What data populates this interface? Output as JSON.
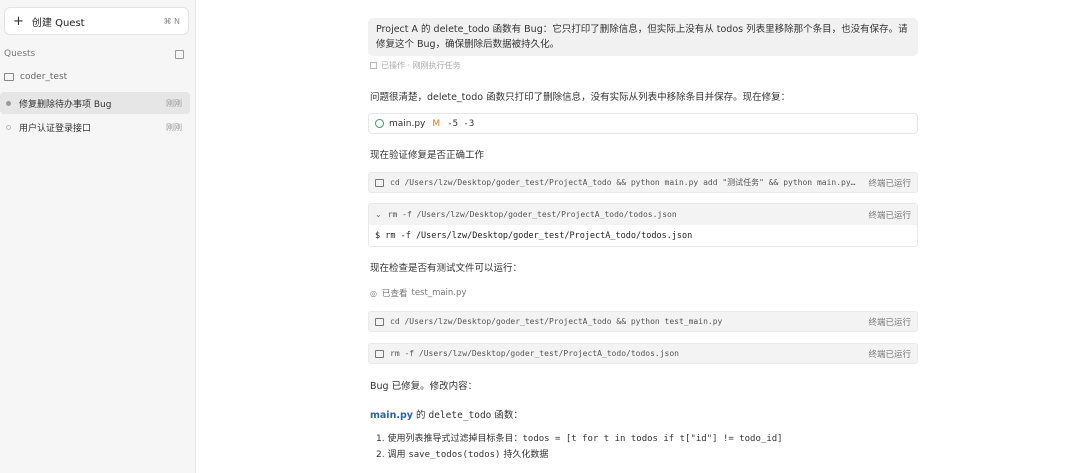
{
  "sidebar": {
    "new_quest_label": "创建 Quest",
    "new_quest_shortcut": "⌘ N",
    "section_title": "Quests",
    "project_name": "coder_test",
    "quests": [
      {
        "title": "修复删除待办事项 Bug",
        "time": "刚刚"
      },
      {
        "title": "用户认证登录接口",
        "time": "刚刚"
      }
    ]
  },
  "chat": {
    "user_message": "Project A 的 delete_todo 函数有 Bug：它只打印了删除信息，但实际上没有从 todos 列表里移除那个条目，也没有保存。请修复这个 Bug，确保删除后数据被持久化。",
    "message_meta": "已操作 · 刚刚执行任务",
    "intro": "问题很清楚，delete_todo 函数只打印了删除信息，没有实际从列表中移除条目并保存。现在修复：",
    "file_edit": {
      "name": "main.py",
      "status": "M",
      "diff": "-5 -3"
    },
    "verify_text": "现在验证修复是否正确工作",
    "cmd1": {
      "text": "cd /Users/lzw/Desktop/goder_test/ProjectA_todo && python main.py add \"测试任务\" && python main.py ad...",
      "status": "终端已运行"
    },
    "cmd2": {
      "text": "rm -f /Users/lzw/Desktop/goder_test/ProjectA_todo/todos.json",
      "status": "终端已运行",
      "output": "$ rm -f /Users/lzw/Desktop/goder_test/ProjectA_todo/todos.json"
    },
    "check_text": "现在检查是否有测试文件可以运行：",
    "viewed_label": "已查看",
    "viewed_file": "test_main.py",
    "cmd3": {
      "text": "cd /Users/lzw/Desktop/goder_test/ProjectA_todo && python test_main.py",
      "status": "终端已运行"
    },
    "cmd4": {
      "text": "rm -f /Users/lzw/Desktop/goder_test/ProjectA_todo/todos.json",
      "status": "终端已运行"
    },
    "fixed_text": "Bug 已修复。修改内容：",
    "fn_file": "main.py",
    "fn_mid": " 的 ",
    "fn_name": "delete_todo",
    "fn_tail": " 函数：",
    "list": [
      {
        "n": "1.",
        "text": "使用列表推导式过滤掉目标条目：",
        "code": "todos = [t for t in todos if t[\"id\"] != todo_id]"
      },
      {
        "n": "2.",
        "text": "调用 ",
        "code": "save_todos(todos)",
        "after": " 持久化数据"
      }
    ]
  }
}
